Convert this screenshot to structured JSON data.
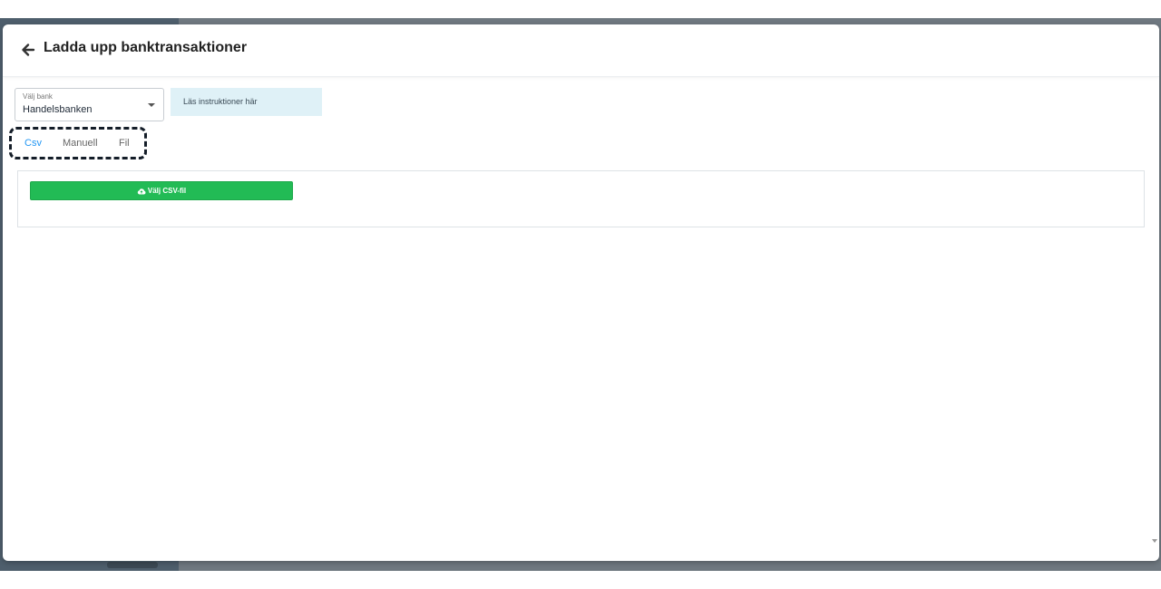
{
  "dialog": {
    "title": "Ladda upp banktransaktioner",
    "back_icon": "arrow-left-icon"
  },
  "bank_select": {
    "label": "Välj bank",
    "value": "Handelsbanken",
    "caret_icon": "caret-down-icon"
  },
  "instructions": {
    "text": "Läs instruktioner här"
  },
  "tabs": [
    {
      "label": "Csv",
      "active": true
    },
    {
      "label": "Manuell",
      "active": false
    },
    {
      "label": "Fil",
      "active": false
    }
  ],
  "csv_panel": {
    "button_label": "Välj CSV-fil",
    "button_icon": "cloud-upload-icon"
  },
  "colors": {
    "accent": "#2196f3",
    "button_green": "#22bb55",
    "info_bg": "#dff1f7",
    "highlight_border": "#141d28"
  }
}
